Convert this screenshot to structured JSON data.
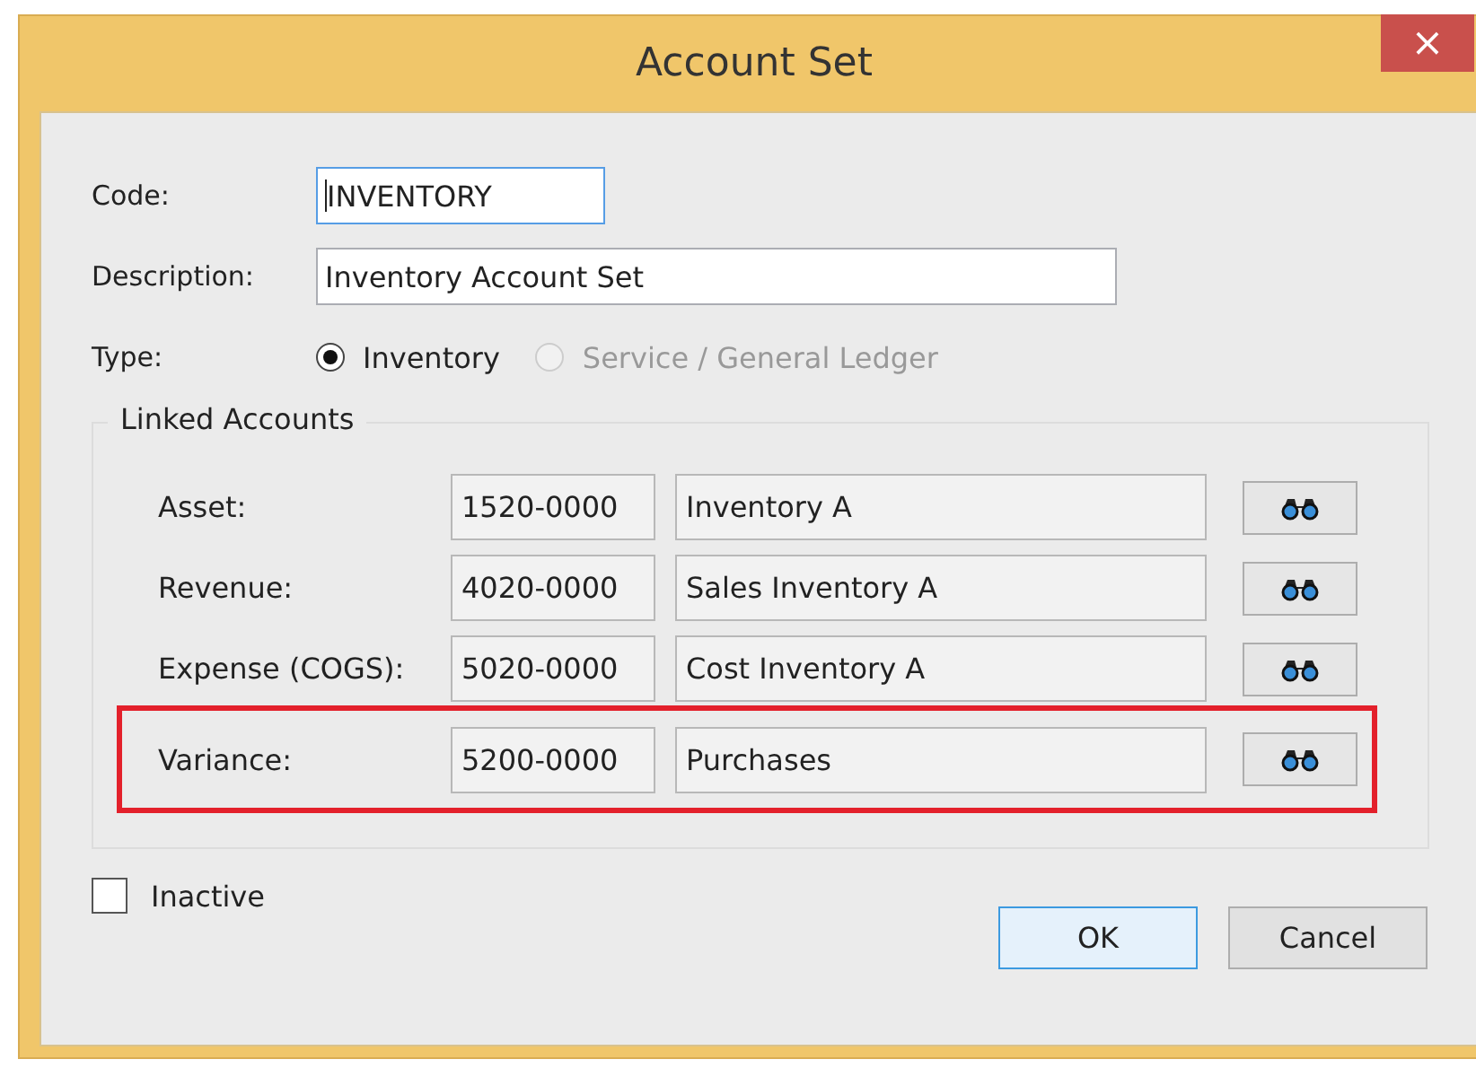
{
  "window": {
    "title": "Account Set",
    "close": "×"
  },
  "fields": {
    "code": {
      "label": "Code:",
      "value": "INVENTORY",
      "focused": true
    },
    "description": {
      "label": "Description:",
      "value": "Inventory Account Set"
    }
  },
  "type": {
    "label": "Type:",
    "options": [
      {
        "label": "Inventory",
        "selected": true,
        "disabled": false
      },
      {
        "label": "Service / General Ledger",
        "selected": false,
        "disabled": true
      }
    ]
  },
  "linked_accounts": {
    "title": "Linked Accounts",
    "rows": [
      {
        "label": "Asset:",
        "account": "1520-0000",
        "name": "Inventory A",
        "highlighted": false
      },
      {
        "label": "Revenue:",
        "account": "4020-0000",
        "name": "Sales Inventory A",
        "highlighted": false
      },
      {
        "label": "Expense (COGS):",
        "account": "5020-0000",
        "name": "Cost Inventory A",
        "highlighted": false
      },
      {
        "label": "Variance:",
        "account": "5200-0000",
        "name": "Purchases",
        "highlighted": true
      }
    ]
  },
  "inactive": {
    "label": "Inactive",
    "checked": false
  },
  "buttons": [
    {
      "label": "OK",
      "default": true
    },
    {
      "label": "Cancel",
      "default": false
    }
  ]
}
